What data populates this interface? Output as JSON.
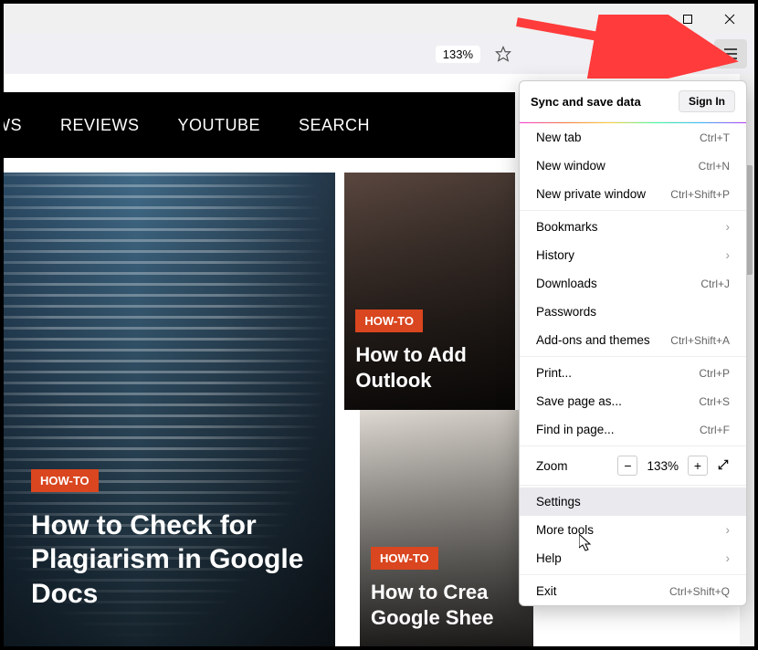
{
  "toolbar": {
    "zoom_pill": "133%"
  },
  "nav": [
    "WS",
    "REVIEWS",
    "YOUTUBE",
    "SEARCH"
  ],
  "cards": {
    "big": {
      "badge": "HOW-TO",
      "title": "How to Check for Plagiarism in Google Docs"
    },
    "topR": {
      "badge": "HOW-TO",
      "title": "How to Add Outlook"
    },
    "botR": {
      "badge": "HOW-TO",
      "title": "How to Crea Google Shee"
    }
  },
  "menu": {
    "header": {
      "label": "Sync and save data",
      "button": "Sign In"
    },
    "group1": [
      {
        "label": "New tab",
        "shortcut": "Ctrl+T"
      },
      {
        "label": "New window",
        "shortcut": "Ctrl+N"
      },
      {
        "label": "New private window",
        "shortcut": "Ctrl+Shift+P"
      }
    ],
    "group2": [
      {
        "label": "Bookmarks",
        "chevron": true
      },
      {
        "label": "History",
        "chevron": true
      },
      {
        "label": "Downloads",
        "shortcut": "Ctrl+J"
      },
      {
        "label": "Passwords"
      },
      {
        "label": "Add-ons and themes",
        "shortcut": "Ctrl+Shift+A"
      }
    ],
    "group3": [
      {
        "label": "Print...",
        "shortcut": "Ctrl+P"
      },
      {
        "label": "Save page as...",
        "shortcut": "Ctrl+S"
      },
      {
        "label": "Find in page...",
        "shortcut": "Ctrl+F"
      }
    ],
    "zoom": {
      "label": "Zoom",
      "value": "133%"
    },
    "group4": [
      {
        "label": "Settings",
        "highlight": true
      },
      {
        "label": "More tools",
        "chevron": true
      },
      {
        "label": "Help",
        "chevron": true
      }
    ],
    "group5": [
      {
        "label": "Exit",
        "shortcut": "Ctrl+Shift+Q"
      }
    ]
  }
}
